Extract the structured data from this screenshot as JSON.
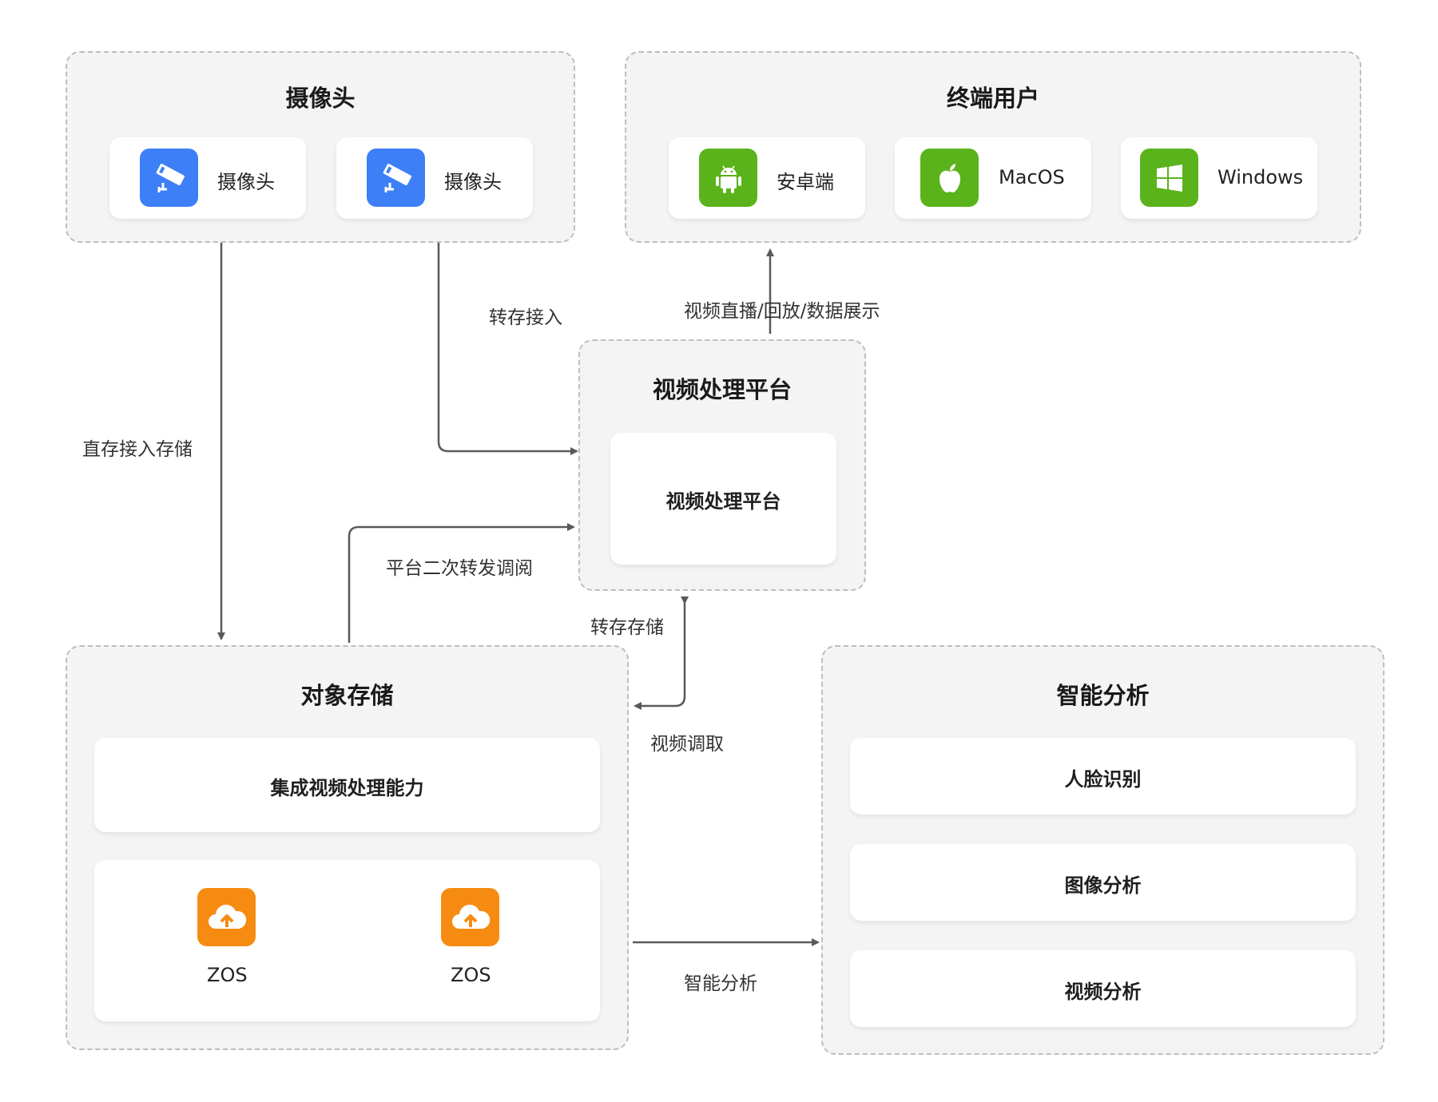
{
  "groups": {
    "cameras": {
      "title": "摄像头",
      "items": [
        {
          "label": "摄像头",
          "icon": "security-camera-icon"
        },
        {
          "label": "摄像头",
          "icon": "security-camera-icon"
        }
      ]
    },
    "endpoints": {
      "title": "终端用户",
      "items": [
        {
          "label": "安卓端",
          "icon": "android-icon"
        },
        {
          "label": "MacOS",
          "icon": "apple-icon"
        },
        {
          "label": "Windows",
          "icon": "windows-icon"
        }
      ]
    },
    "video_platform": {
      "title": "视频处理平台",
      "inner_label": "视频处理平台"
    },
    "object_storage": {
      "title": "对象存储",
      "capability": "集成视频处理能力",
      "nodes": [
        {
          "label": "ZOS",
          "icon": "cloud-upload-icon"
        },
        {
          "label": "ZOS",
          "icon": "cloud-upload-icon"
        }
      ]
    },
    "ai_analysis": {
      "title": "智能分析",
      "items": [
        "人脸识别",
        "图像分析",
        "视频分析"
      ]
    }
  },
  "edges": {
    "direct_storage": "直存接入存储",
    "relay_access": "转存接入",
    "live_playback": "视频直播/回放/数据展示",
    "platform_forward": "平台二次转发调阅",
    "relay_storage": "转存存储",
    "video_retrieval": "视频调取",
    "smart_analysis": "智能分析"
  },
  "colors": {
    "camera_icon": "#3d7ff6",
    "endpoint_icon": "#5bb31c",
    "storage_icon": "#f68b12",
    "arrow": "#595959"
  }
}
